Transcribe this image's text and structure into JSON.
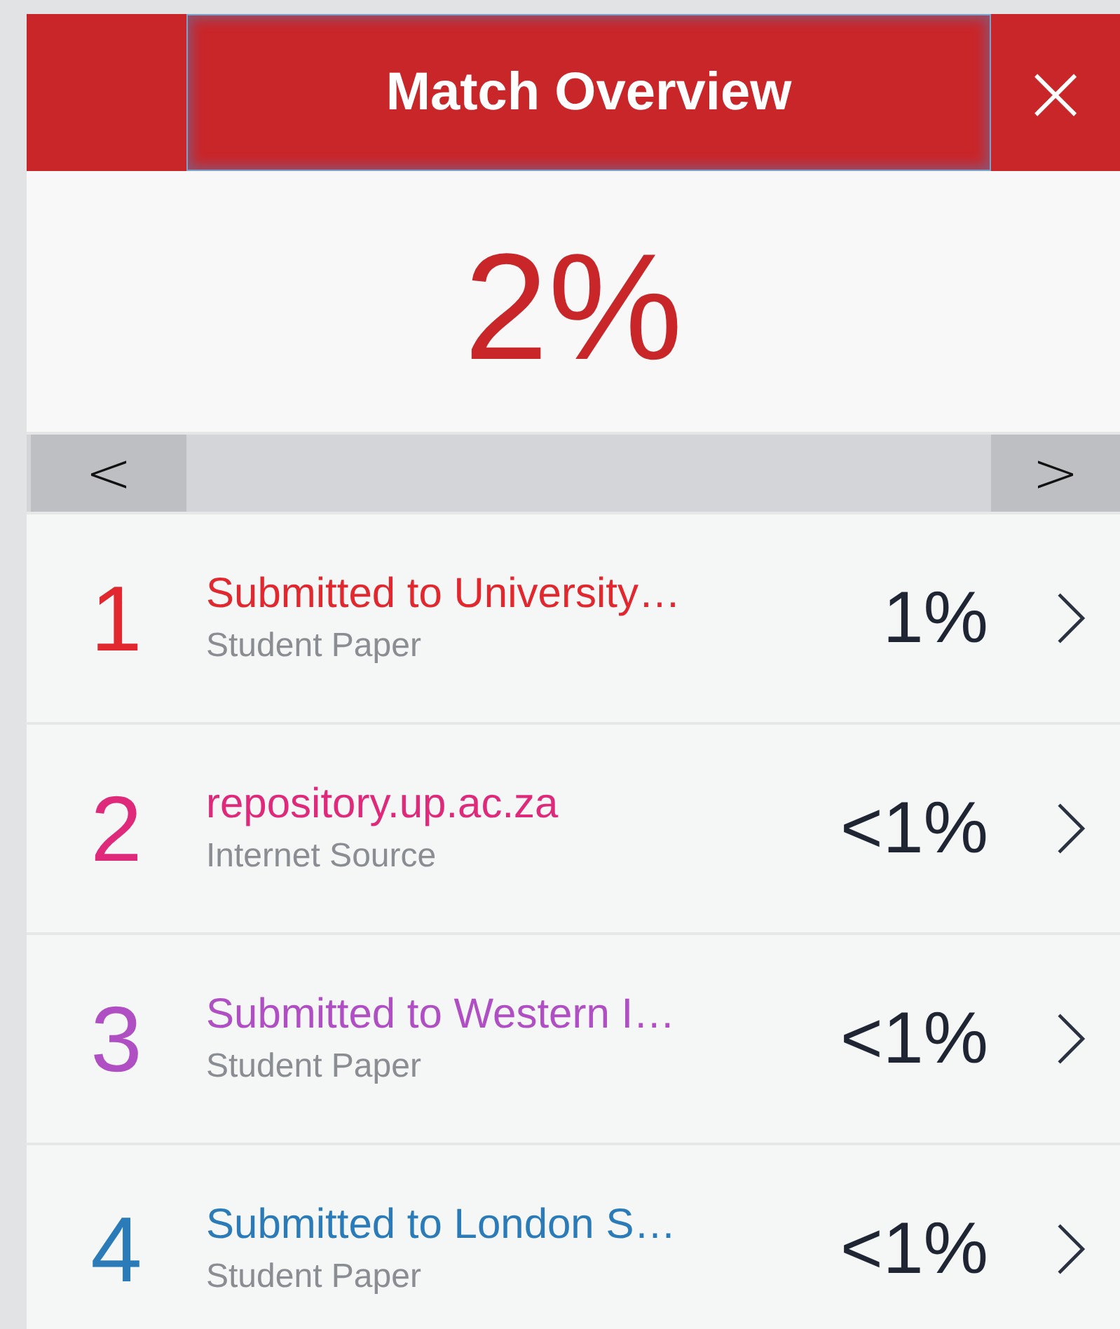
{
  "header": {
    "title": "Match Overview",
    "title_focused": true,
    "close": "×"
  },
  "score": "2%",
  "pager": {
    "prev": "<",
    "next": ">"
  },
  "matches": [
    {
      "rank": "1",
      "source": "Submitted to University…",
      "type": "Student Paper",
      "percent": "1%",
      "color": "#e0282e"
    },
    {
      "rank": "2",
      "source": "repository.up.ac.za",
      "type": "Internet Source",
      "percent": "<1%",
      "color": "#df2a7b"
    },
    {
      "rank": "3",
      "source": "Submitted to Western I…",
      "type": "Student Paper",
      "percent": "<1%",
      "color": "#b04fc4"
    },
    {
      "rank": "4",
      "source": "Submitted to London S…",
      "type": "Student Paper",
      "percent": "<1%",
      "color": "#2a7bb8"
    }
  ]
}
